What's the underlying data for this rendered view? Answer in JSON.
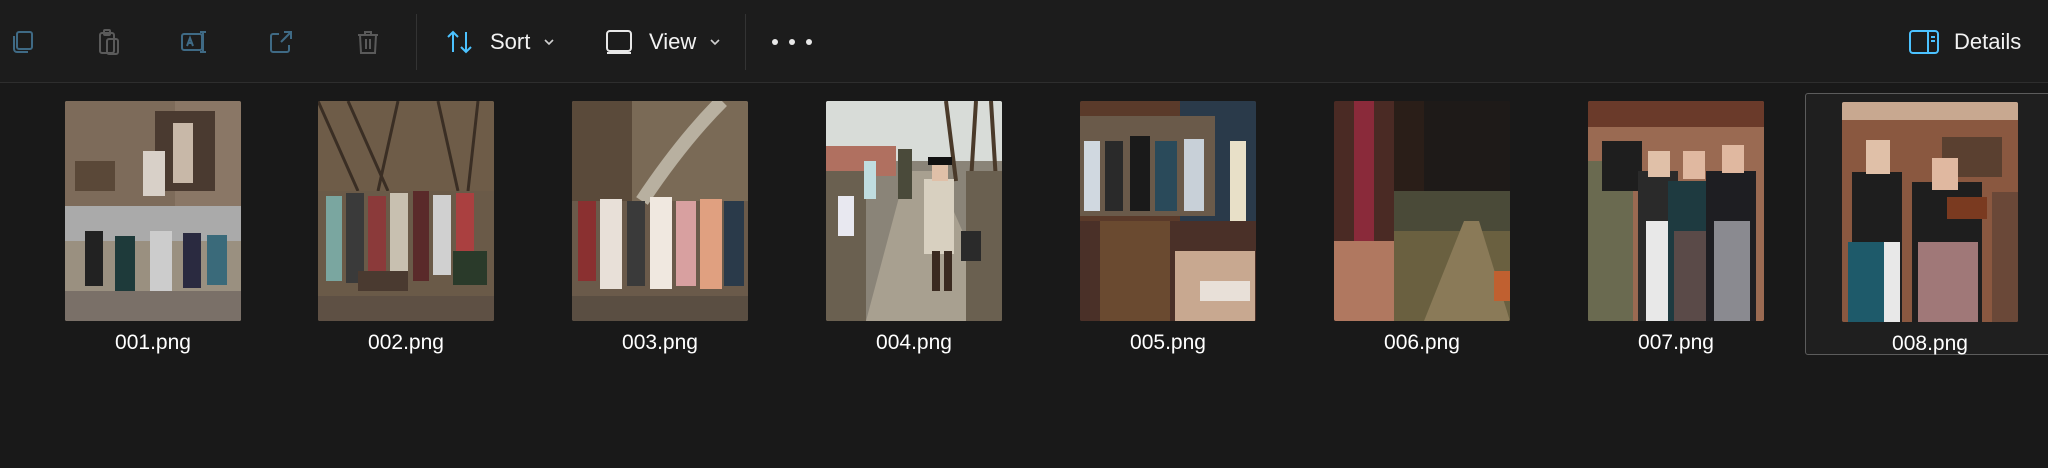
{
  "toolbar": {
    "sort_label": "Sort",
    "view_label": "View",
    "details_label": "Details",
    "icons": [
      "copy-icon",
      "paste-icon",
      "rename-icon",
      "share-icon",
      "delete-icon",
      "sort-icon",
      "view-icon",
      "more-icon",
      "details-pane-icon"
    ]
  },
  "colors": {
    "background": "#191919",
    "accent": "#4cc2ff",
    "text": "#ffffff"
  },
  "files": [
    {
      "name": "001.png",
      "selected": false
    },
    {
      "name": "002.png",
      "selected": false
    },
    {
      "name": "003.png",
      "selected": false
    },
    {
      "name": "004.png",
      "selected": false
    },
    {
      "name": "005.png",
      "selected": false
    },
    {
      "name": "006.png",
      "selected": false
    },
    {
      "name": "007.png",
      "selected": false
    },
    {
      "name": "008.png",
      "selected": true
    }
  ]
}
